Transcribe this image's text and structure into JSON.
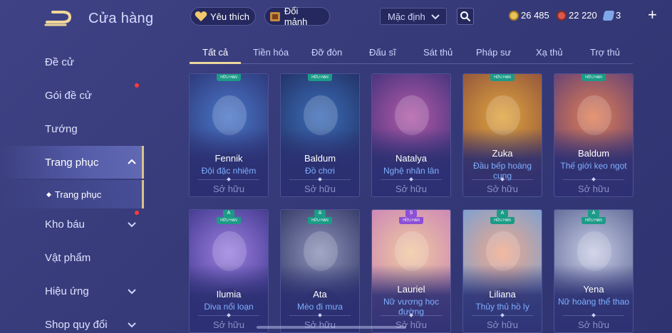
{
  "header": {
    "title": "Cửa hàng",
    "favorites_label": "Yêu thích",
    "exchange_label": "Đổi mảnh",
    "sort": {
      "selected": "Mặc định"
    },
    "currencies": [
      {
        "value": "26 485",
        "color": "#e8c25a",
        "icon": "gold-coin-icon"
      },
      {
        "value": "22 220",
        "color": "#d9584c",
        "icon": "voucher-icon"
      },
      {
        "value": "3",
        "color": "#7fa6e8",
        "icon": "ticket-icon"
      }
    ]
  },
  "sidebar": {
    "items": [
      {
        "label": "Đề cử"
      },
      {
        "label": "Gói đề cử"
      },
      {
        "label": "Tướng"
      },
      {
        "label": "Trang phục"
      },
      {
        "label": "Kho báu"
      },
      {
        "label": "Vật phẩm"
      },
      {
        "label": "Hiệu ứng"
      },
      {
        "label": "Shop quy đổi"
      }
    ],
    "subitem": {
      "label": "Trang phục"
    }
  },
  "tabs": [
    "Tất cả",
    "Tiền hóa",
    "Đỡ đòn",
    "Đấu sĩ",
    "Sát thủ",
    "Pháp sư",
    "Xạ thủ",
    "Trợ thủ"
  ],
  "cards": [
    {
      "hero": "Fennik",
      "skin": "Đội đặc nhiệm",
      "status": "Sở hữu",
      "badge": "HỮU HẠN",
      "grade": "",
      "color1": "#4a77c9",
      "color2": "#2a3170"
    },
    {
      "hero": "Baldum",
      "skin": "Đồ chơi",
      "status": "Sở hữu",
      "badge": "HỮU HẠN",
      "grade": "",
      "color1": "#3c6db8",
      "color2": "#1f2b5c"
    },
    {
      "hero": "Natalya",
      "skin": "Nghệ nhân lân",
      "status": "Sở hữu",
      "badge": "",
      "grade": "",
      "color1": "#b25aa8",
      "color2": "#3a2f78"
    },
    {
      "hero": "Zuka",
      "skin": "Đầu bếp hoàng cung",
      "status": "Sở hữu",
      "badge": "HỮU HẠN",
      "grade": "",
      "color1": "#e0a53f",
      "color2": "#8a4c3b"
    },
    {
      "hero": "Baldum",
      "skin": "Thế giới kẹo ngọt",
      "status": "Sở hữu",
      "badge": "HỮU HẠN",
      "grade": "",
      "color1": "#e07f54",
      "color2": "#5a3b78"
    },
    {
      "hero": "Ilumia",
      "skin": "Diva nổi loạn",
      "status": "Sở hữu",
      "badge": "HỮU HẠN",
      "grade": "A",
      "color1": "#9b7fe0",
      "color2": "#3a3288"
    },
    {
      "hero": "Ata",
      "skin": "Mèo đi mưa",
      "status": "Sở hữu",
      "badge": "HỮU HẠN",
      "grade": "A",
      "color1": "#8c93b8",
      "color2": "#2c3060"
    },
    {
      "hero": "Lauriel",
      "skin": "Nữ vương học đường",
      "status": "Sở hữu",
      "badge": "HỮU HẠN",
      "grade": "S",
      "color1": "#f0c9a0",
      "color2": "#c87fb8"
    },
    {
      "hero": "Liliana",
      "skin": "Thủy thủ hồ ly",
      "status": "Sở hữu",
      "badge": "HỮU HẠN",
      "grade": "A",
      "color1": "#f0a98c",
      "color2": "#6f9fd8"
    },
    {
      "hero": "Yena",
      "skin": "Nữ hoàng thể thao",
      "status": "Sở hữu",
      "badge": "HỮU HẠN",
      "grade": "A",
      "color1": "#c9cde6",
      "color2": "#55608f"
    }
  ]
}
